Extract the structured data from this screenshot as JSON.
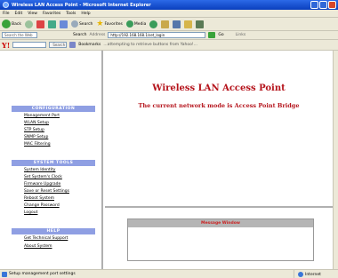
{
  "window": {
    "title": "Wireless LAN Access Point - Microsoft Internet Explorer"
  },
  "menu": [
    "File",
    "Edit",
    "View",
    "Favorites",
    "Tools",
    "Help"
  ],
  "toolbar": {
    "back": "Back",
    "search": "Search",
    "favorites": "Favorites",
    "media": "Media"
  },
  "addressbar": {
    "search_web": "Search the Web",
    "search2": "Search",
    "address_label": "Address",
    "url": "http://192.168.168.1/set_login",
    "go": "Go",
    "links": "Links"
  },
  "linkbar": {
    "yahoo": "Y!",
    "search_btn": "Search",
    "bookmarks": "Bookmarks",
    "message": "...attempting to retrieve buttons from Yahoo!..."
  },
  "sidebar": {
    "configuration": {
      "title": "CONFIGURATION",
      "links": [
        "Management Port",
        "WLAN Setup",
        "STP Setup",
        "SNMP Setup",
        "MAC Filtering"
      ]
    },
    "system_tools": {
      "title": "SYSTEM TOOLS",
      "links": [
        "System Identity",
        "Set System's Clock",
        "Firmware Upgrade",
        "Save or Reset Settings",
        "Reboot System",
        "Change Password",
        "Logout"
      ]
    },
    "help": {
      "title": "HELP",
      "links": [
        "Get Technical Support",
        "About System"
      ]
    }
  },
  "main": {
    "title": "Wireless LAN Access Point",
    "mode_text": "The current network mode is Access Point Bridge"
  },
  "message_window": {
    "title": "Message Window"
  },
  "status": {
    "text": "Setup management port settings",
    "zone": "Internet"
  }
}
